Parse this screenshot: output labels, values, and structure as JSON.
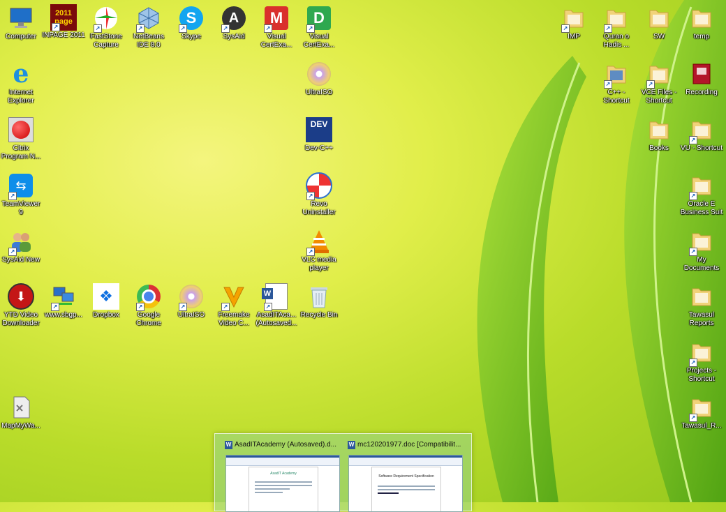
{
  "desktop": {
    "icons": [
      {
        "id": "computer",
        "label": "Computer",
        "icon": "computer-icon"
      },
      {
        "id": "inpage",
        "label": "INPAGE 2011",
        "icon": "inpage-icon",
        "img_text": "2011 page"
      },
      {
        "id": "faststone",
        "label": "FastStone Capture",
        "icon": "faststone-capture-icon"
      },
      {
        "id": "netbeans",
        "label": "NetBeans IDE 8.0",
        "icon": "netbeans-icon"
      },
      {
        "id": "skype",
        "label": "Skype",
        "icon": "skype-icon"
      },
      {
        "id": "sysaid",
        "label": "SysAid",
        "icon": "sysaid-icon"
      },
      {
        "id": "visualcert1",
        "label": "Visual CertExa...",
        "icon": "visual-certexam-manager-icon",
        "img_text": "M"
      },
      {
        "id": "visualcert2",
        "label": "Visual CertExa...",
        "icon": "visual-certexam-designer-icon",
        "img_text": "D"
      },
      {
        "id": "ie",
        "label": "Internet Explorer",
        "icon": "internet-explorer-icon"
      },
      {
        "id": "ultraiso1",
        "label": "UltraISO",
        "icon": "ultraiso-icon"
      },
      {
        "id": "citrix",
        "label": "Citrix Program N...",
        "icon": "citrix-icon"
      },
      {
        "id": "devcpp",
        "label": "Dev-C++",
        "icon": "dev-cpp-icon",
        "img_text": "DEV"
      },
      {
        "id": "teamviewer",
        "label": "TeamViewer 9",
        "icon": "teamviewer-icon"
      },
      {
        "id": "revo",
        "label": "Revo Uninstaller",
        "icon": "revo-uninstaller-icon"
      },
      {
        "id": "sysaidnew",
        "label": "SysAid New",
        "icon": "users-icon"
      },
      {
        "id": "vlc",
        "label": "VLC media player",
        "icon": "vlc-icon"
      },
      {
        "id": "ytd",
        "label": "YTD Video Downloader",
        "icon": "ytd-icon"
      },
      {
        "id": "sbgp",
        "label": "www.sbgp...",
        "icon": "network-computers-icon"
      },
      {
        "id": "dropbox",
        "label": "Dropbox",
        "icon": "dropbox-icon"
      },
      {
        "id": "chrome",
        "label": "Google Chrome",
        "icon": "chrome-icon"
      },
      {
        "id": "ultraiso2",
        "label": "UltraISO",
        "icon": "ultraiso-icon"
      },
      {
        "id": "freemake",
        "label": "Freemake Video C...",
        "icon": "freemake-icon"
      },
      {
        "id": "asaddoc",
        "label": "AsadITAca... (Autosaved...",
        "icon": "word-document-icon",
        "img_text": "W"
      },
      {
        "id": "recyclebin",
        "label": "Recycle Bin",
        "icon": "recycle-bin-icon"
      },
      {
        "id": "mapmyway",
        "label": "MapMyWa...",
        "icon": "mapmyway-icon"
      },
      {
        "id": "imp",
        "label": "IMP",
        "icon": "folder-icon"
      },
      {
        "id": "quran",
        "label": "Quran o Hadis ...",
        "icon": "folder-icon"
      },
      {
        "id": "sw",
        "label": "SW",
        "icon": "folder-icon"
      },
      {
        "id": "temp",
        "label": "temp",
        "icon": "folder-icon"
      },
      {
        "id": "cppshortcut",
        "label": "C++ - Shortcut",
        "icon": "folder-icon"
      },
      {
        "id": "vcefiles",
        "label": "VCE Files - Shortcut",
        "icon": "folder-icon"
      },
      {
        "id": "recording",
        "label": "Recording",
        "icon": "recording-icon"
      },
      {
        "id": "books",
        "label": "Books",
        "icon": "folder-icon"
      },
      {
        "id": "vushortcut",
        "label": "VU - Shortcut",
        "icon": "folder-icon"
      },
      {
        "id": "oracle",
        "label": "Oracle E Business Suit",
        "icon": "folder-icon"
      },
      {
        "id": "mydocs",
        "label": "My Documents",
        "icon": "folder-icon"
      },
      {
        "id": "tawasul",
        "label": "Tawasul Reports",
        "icon": "folder-icon"
      },
      {
        "id": "projects",
        "label": "Projects - Shortcut",
        "icon": "folder-icon"
      },
      {
        "id": "tawasulr",
        "label": "Tawasul_R...",
        "icon": "folder-icon"
      }
    ]
  },
  "taskbar_preview": {
    "thumbnails": [
      {
        "title": "AsadITAcademy (Autosaved).d...",
        "icon": "word-icon",
        "icon_letter": "W",
        "doc_heading": "AsadIT Academy"
      },
      {
        "title": "mc120201977.doc [Compatibilit...",
        "icon": "word-icon",
        "icon_letter": "W",
        "doc_heading": "Software Requirement Specification"
      }
    ]
  },
  "colors": {
    "wallpaper_light": "#f4f57e",
    "wallpaper_dark": "#96c81e",
    "leaf": "#5fbf1a",
    "word_blue": "#2b579a"
  }
}
